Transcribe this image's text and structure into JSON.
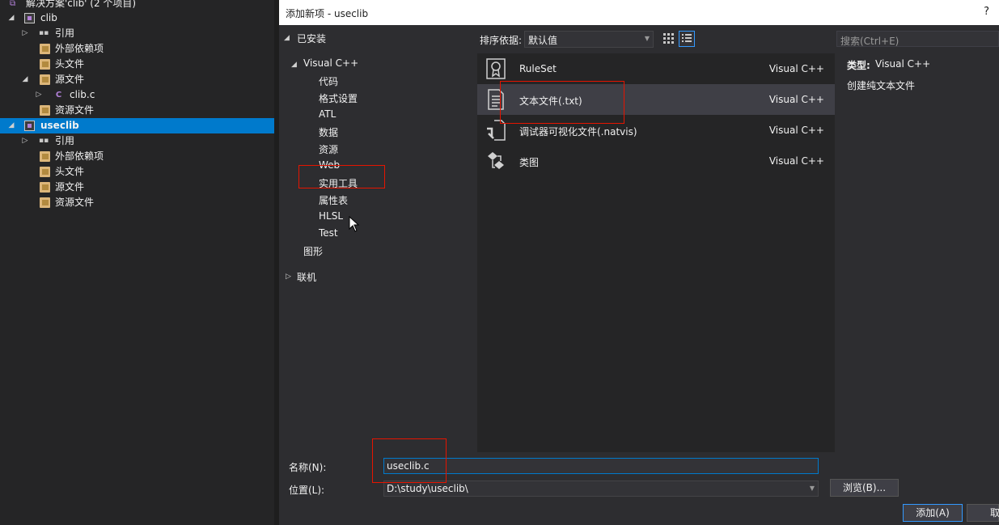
{
  "explorer": {
    "solution_label": "解决方案'clib' (2 个项目)",
    "items": [
      {
        "label": "clib"
      },
      {
        "label": "引用"
      },
      {
        "label": "外部依赖项"
      },
      {
        "label": "头文件"
      },
      {
        "label": "源文件"
      },
      {
        "label": "clib.c"
      },
      {
        "label": "资源文件"
      },
      {
        "label": "useclib"
      },
      {
        "label": "引用"
      },
      {
        "label": "外部依赖项"
      },
      {
        "label": "头文件"
      },
      {
        "label": "源文件"
      },
      {
        "label": "资源文件"
      }
    ],
    "selected_item": "useclib"
  },
  "dialog": {
    "title": "添加新项 - useclib",
    "help": "?",
    "categories": {
      "installed": "已安装",
      "visual_cpp": "Visual C++",
      "children": [
        "代码",
        "格式设置",
        "ATL",
        "数据",
        "资源",
        "Web",
        "实用工具",
        "属性表",
        "HLSL",
        "Test"
      ],
      "graphics": "图形",
      "online": "联机"
    },
    "sort": {
      "label": "排序依据:",
      "value": "默认值"
    },
    "search_placeholder": "搜索(Ctrl+E)",
    "templates": [
      {
        "name": "RuleSet",
        "lang": "Visual C++",
        "icon": "ruleset-icon"
      },
      {
        "name": "文本文件(.txt)",
        "lang": "Visual C++",
        "icon": "text-file-icon"
      },
      {
        "name": "调试器可视化文件(.natvis)",
        "lang": "Visual C++",
        "icon": "natvis-icon"
      },
      {
        "name": "类图",
        "lang": "Visual C++",
        "icon": "class-diagram-icon"
      }
    ],
    "selected_template": "文本文件(.txt)",
    "details": {
      "type_label": "类型:",
      "type_value": "Visual C++",
      "description": "创建纯文本文件"
    },
    "form": {
      "name_label": "名称(N):",
      "name_value": "useclib.c",
      "location_label": "位置(L):",
      "location_value": "D:\\study\\useclib\\",
      "browse_label": "浏览(B)...",
      "add_label": "添加(A)",
      "cancel_label": "取"
    }
  },
  "colors": {
    "accent": "#007acc",
    "highlight_box": "#e51400",
    "selected_row": "#3f3f46"
  }
}
